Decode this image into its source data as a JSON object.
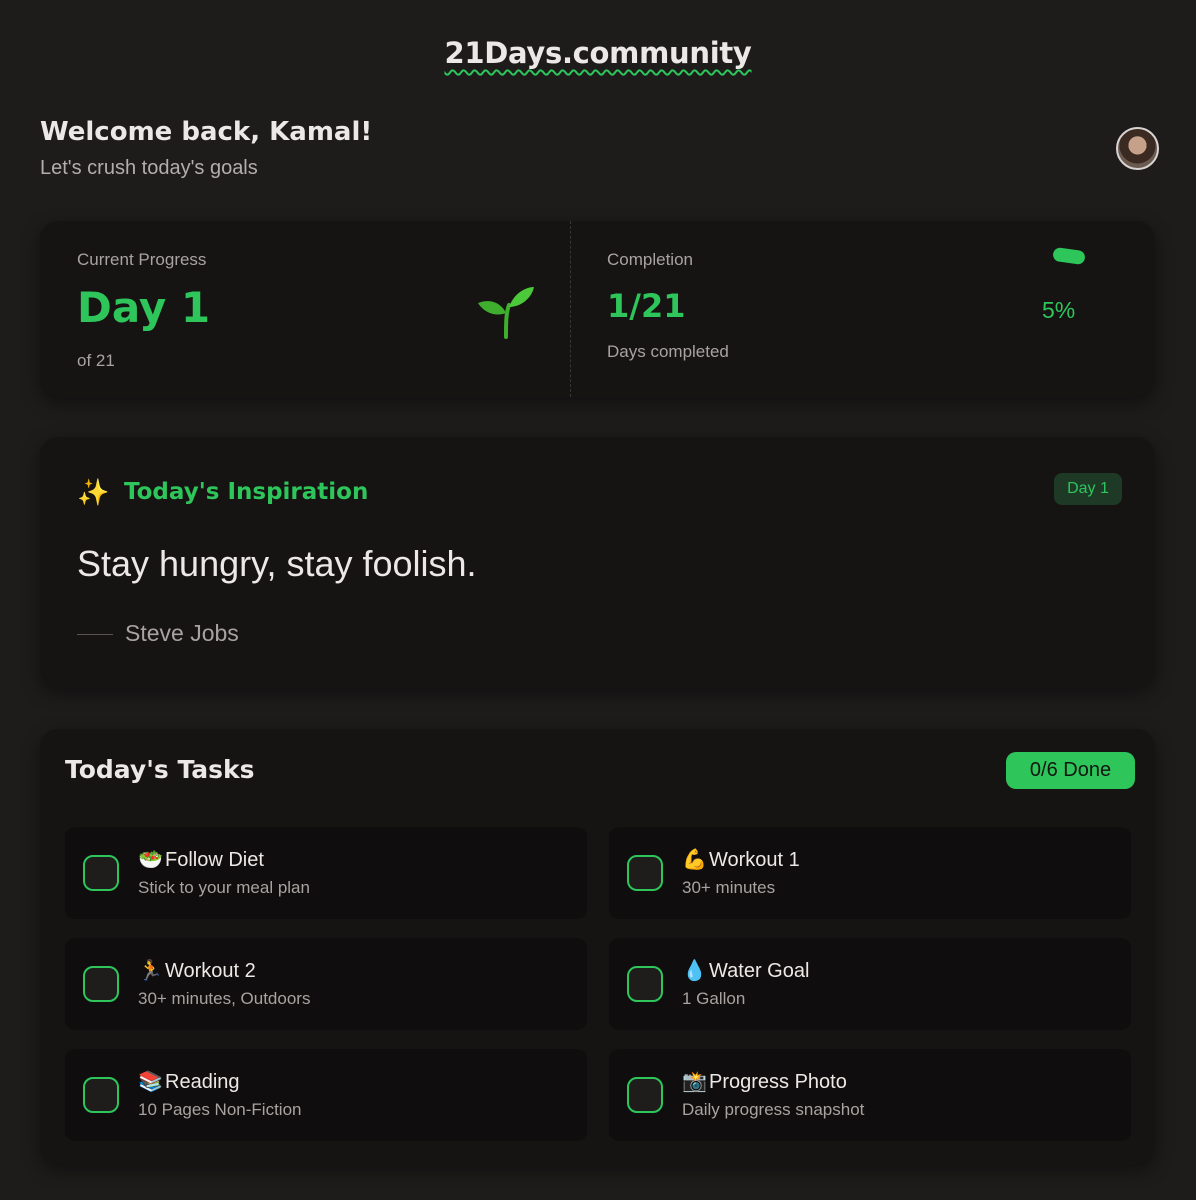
{
  "brand": "21Days.community",
  "header": {
    "welcome": "Welcome back, Kamal!",
    "subtitle": "Let's crush today's goals"
  },
  "progress": {
    "current_label": "Current Progress",
    "day": "Day 1",
    "of_total": "of 21",
    "completion_label": "Completion",
    "completed": "1/21",
    "completed_sub": "Days completed",
    "percent": "5%",
    "percent_value": 0.05
  },
  "inspiration": {
    "icon": "✨",
    "title": "Today's Inspiration",
    "badge": "Day 1",
    "quote": "Stay hungry, stay foolish.",
    "author": "Steve Jobs"
  },
  "tasks": {
    "title": "Today's Tasks",
    "done_badge": "0/6 Done",
    "items": [
      {
        "emoji": "🥗",
        "name": "Follow Diet",
        "desc": "Stick to your meal plan"
      },
      {
        "emoji": "💪",
        "name": "Workout 1",
        "desc": "30+ minutes"
      },
      {
        "emoji": "🏃",
        "name": "Workout 2",
        "desc": "30+ minutes, Outdoors"
      },
      {
        "emoji": "💧",
        "name": "Water Goal",
        "desc": "1 Gallon"
      },
      {
        "emoji": "📚",
        "name": "Reading",
        "desc": "10 Pages Non-Fiction"
      },
      {
        "emoji": "📸",
        "name": "Progress Photo",
        "desc": "Daily progress snapshot"
      }
    ]
  },
  "colors": {
    "accent": "#2ec55b",
    "background": "#1e1b1b",
    "card": "#161313"
  }
}
